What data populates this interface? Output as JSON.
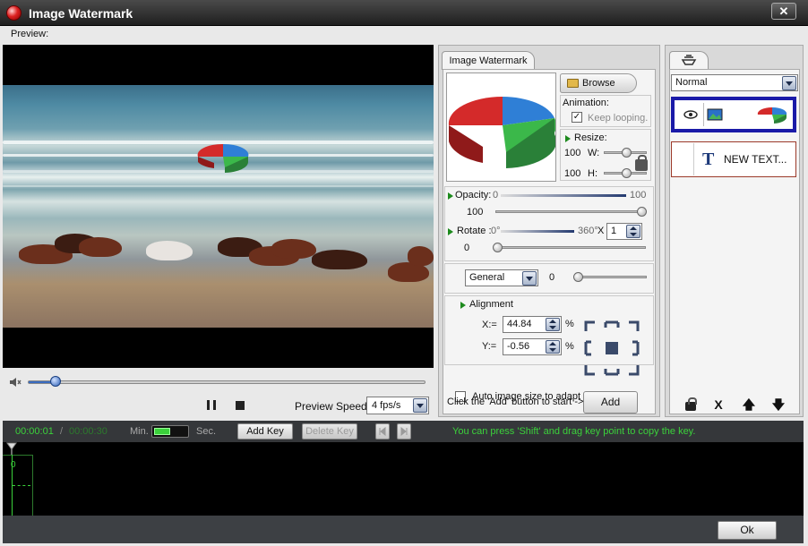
{
  "window": {
    "title": "Image Watermark",
    "close_glyph": "✕",
    "icon": "app-icon"
  },
  "preview": {
    "label": "Preview:"
  },
  "player": {
    "seek_fraction": 0.07,
    "speed_label": "Preview Speed:",
    "speed_value": "4 fps/s",
    "icons": [
      "volume-icon",
      "pause-icon",
      "stop-icon"
    ]
  },
  "watermark_panel": {
    "tab_label": "Image Watermark",
    "browse_label": "Browse",
    "animation_label": "Animation:",
    "keep_looping_label": "Keep looping.",
    "keep_looping_checked": "✓",
    "resize_label": "Resize:",
    "width_value": "100",
    "width_label": "W:",
    "height_value": "100",
    "height_label": "H:",
    "opacity_label": "Opacity:",
    "opacity_min": "0",
    "opacity_max": "100",
    "opacity_value": "100",
    "rotate_label": "Rotate :",
    "rotate_min": "0°",
    "rotate_max": "360°",
    "rotate_x": "X",
    "rotate_count": "1",
    "rotate_value": "0",
    "mode_value": "General",
    "mode_amount": "0",
    "alignment_label": "Alignment",
    "x_label": "X:=",
    "x_value": "44.84",
    "y_label": "Y:=",
    "y_value": "-0.56",
    "percent": "%",
    "auto_size_label": "Auto image size to adapt each videos.",
    "hint": "Click the 'Add' button to start ->",
    "add_label": "Add"
  },
  "layers_panel": {
    "blend_mode": "Normal",
    "text_layer_label": "NEW TEXT...",
    "text_glyph": "T",
    "action_icons": [
      "lock-icon",
      "delete-icon",
      "move-up-icon",
      "move-down-icon"
    ],
    "delete_glyph": "X",
    "up_glyph": "🡅",
    "down_glyph": "🡇"
  },
  "timeline": {
    "current_time": "00:00:01",
    "separator": "/",
    "total_time": "00:00:30",
    "min_label": "Min.",
    "sec_label": "Sec.",
    "add_key_label": "Add Key",
    "delete_key_label": "Delete Key",
    "hint": "You can press 'Shift' and drag key point to copy the key.",
    "ruler_zero": "0"
  },
  "footer": {
    "ok_label": "Ok"
  },
  "colors": {
    "accent": "#1a1aa8",
    "timeline_green": "#3bd13b",
    "timeline_bg": "#35373a"
  }
}
